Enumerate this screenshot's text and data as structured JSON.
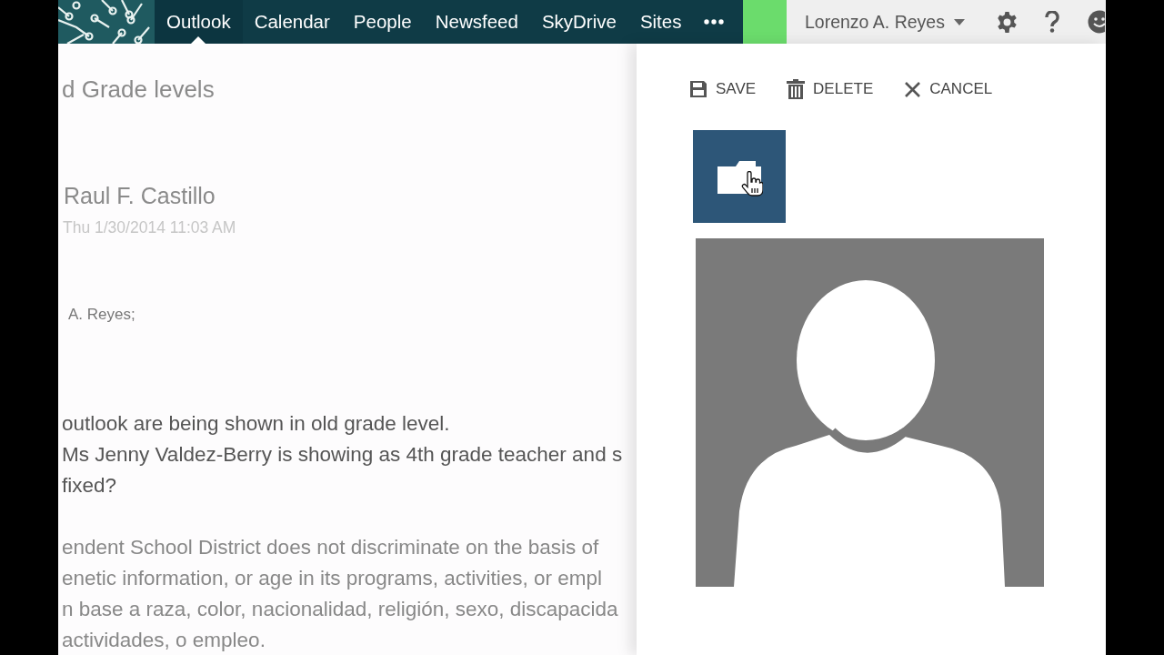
{
  "nav": {
    "items": [
      {
        "label": "Outlook",
        "selected": true
      },
      {
        "label": "Calendar",
        "selected": false
      },
      {
        "label": "People",
        "selected": false
      },
      {
        "label": "Newsfeed",
        "selected": false
      },
      {
        "label": "SkyDrive",
        "selected": false
      },
      {
        "label": "Sites",
        "selected": false
      }
    ]
  },
  "user": {
    "name": "Lorenzo A. Reyes"
  },
  "message": {
    "subject": "d Grade levels",
    "sender": "Raul F. Castillo",
    "date": "Thu 1/30/2014 11:03 AM",
    "recipients": "A. Reyes;",
    "body": [
      "outlook are being shown in old grade level.",
      "Ms Jenny Valdez-Berry is showing as 4th grade teacher and s",
      "fixed?"
    ],
    "footer": [
      "endent School District does not discriminate on the basis of",
      "enetic information, or age in its programs, activities, or empl",
      "n base a raza, color, nacionalidad, religión, sexo, discapacida",
      "actividades, o empleo."
    ]
  },
  "panel": {
    "actions": [
      {
        "kind": "save",
        "label": "SAVE"
      },
      {
        "kind": "delete",
        "label": "DELETE"
      },
      {
        "kind": "cancel",
        "label": "CANCEL"
      }
    ]
  }
}
